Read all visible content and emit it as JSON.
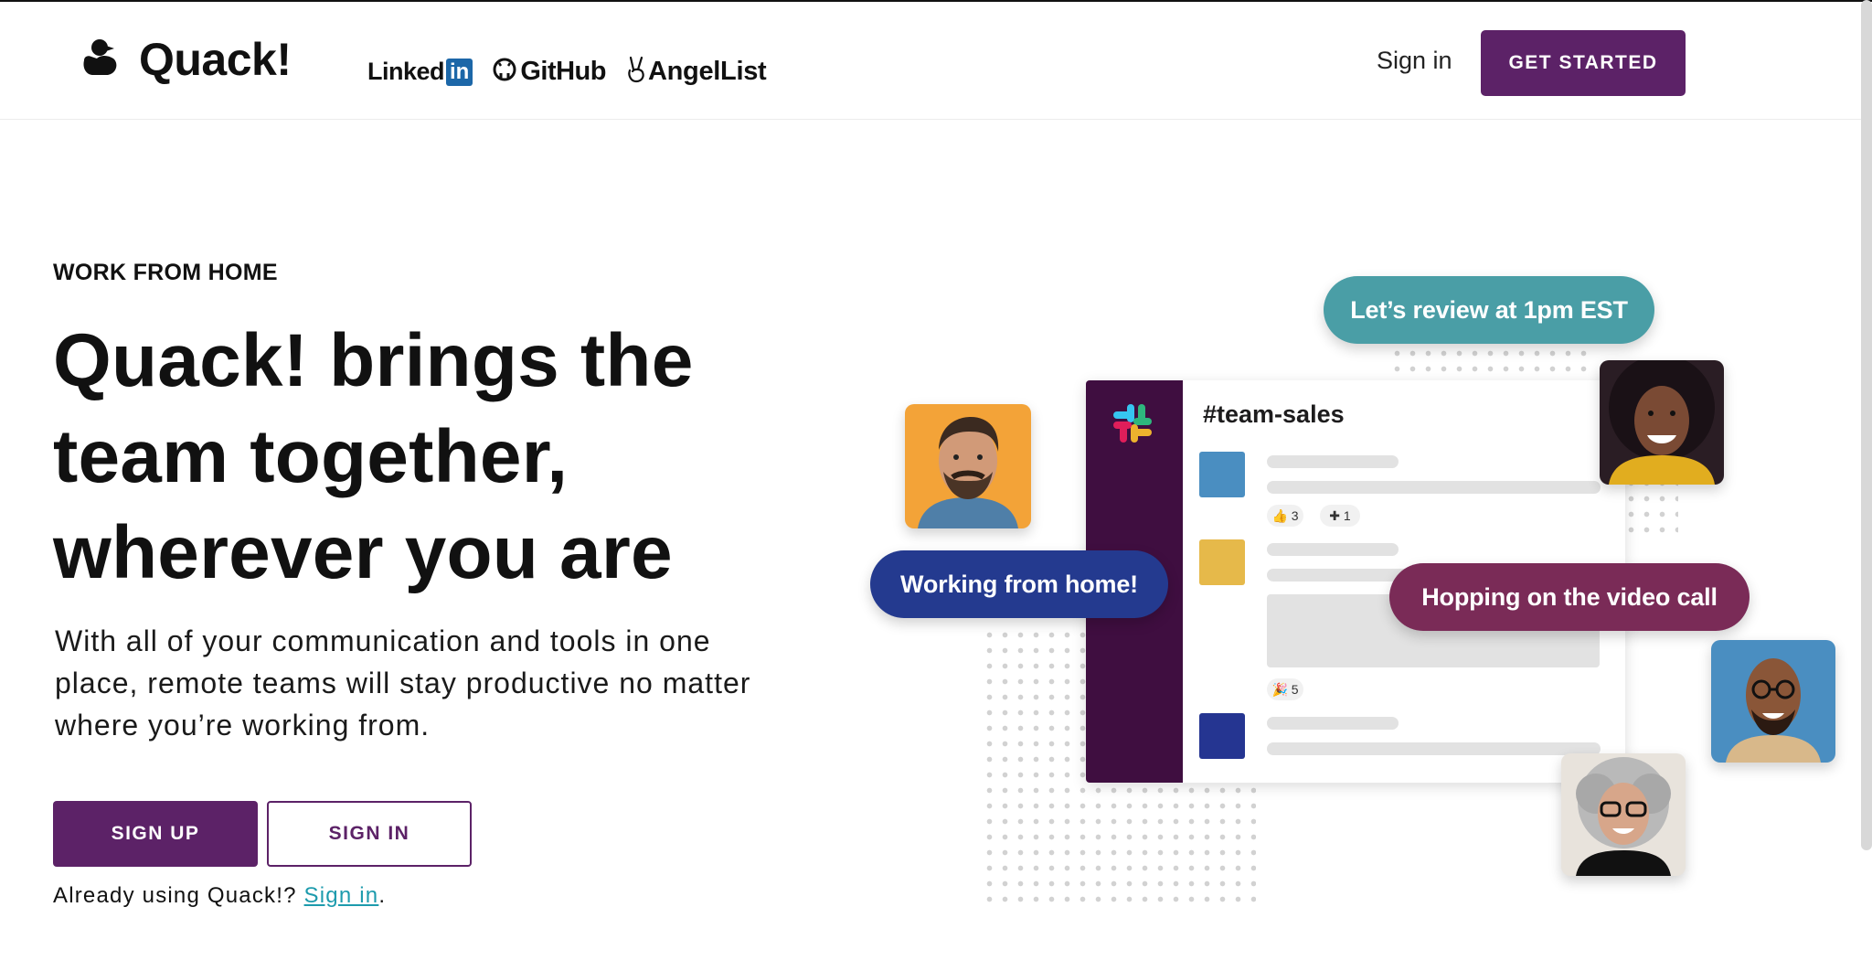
{
  "header": {
    "logo_text": "Quack!",
    "partners": {
      "linkedin_text": "Linked",
      "linkedin_box": "in",
      "github": "GitHub",
      "angellist": "AngelList"
    },
    "sign_in": "Sign in",
    "get_started": "GET STARTED"
  },
  "hero": {
    "eyebrow": "WORK FROM HOME",
    "headline": "Quack! brings the team together, wherever you are",
    "subtext": "With all of your communication and tools in one place, remote teams will stay productive no matter where you’re working from.",
    "sign_up": "SIGN UP",
    "sign_in": "SIGN IN",
    "already_prefix": "Already using Quack!? ",
    "already_link": "Sign in",
    "already_suffix": "."
  },
  "illustration": {
    "channel": "#team-sales",
    "bubble_review": "Let’s review at 1pm EST",
    "bubble_home": "Working from home!",
    "bubble_video": "Hopping on the video call",
    "reaction_thumbs": "👍 3",
    "reaction_plus": "✚ 1",
    "reaction_party": "🎉 5"
  },
  "colors": {
    "brand_purple": "#5c2267",
    "sidebar_purple": "#3f0e40",
    "teal": "#4a9ea6",
    "navy": "#243a8f",
    "maroon": "#7a2b57",
    "link_teal": "#1d9bad"
  },
  "icons": [
    "duck-icon",
    "github-icon",
    "angellist-icon",
    "slack-logo-icon"
  ]
}
